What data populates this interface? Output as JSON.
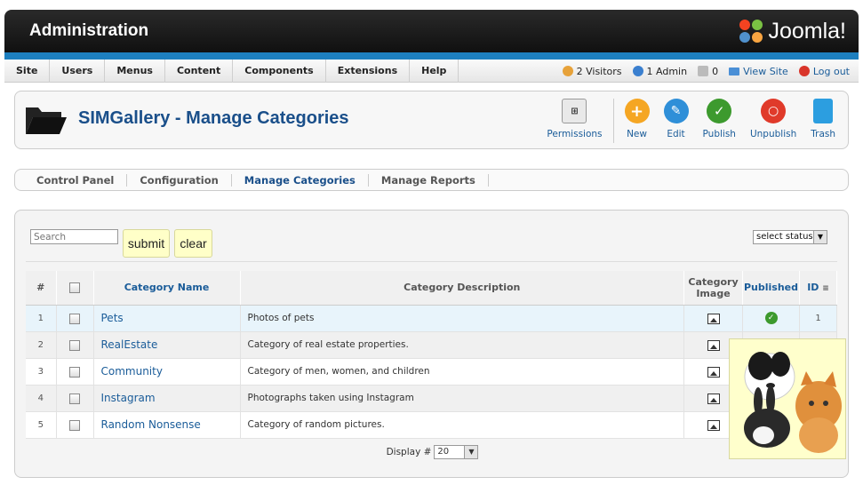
{
  "header": {
    "title": "Administration",
    "brand": "Joomla!"
  },
  "menu": {
    "items": [
      "Site",
      "Users",
      "Menus",
      "Content",
      "Components",
      "Extensions",
      "Help"
    ]
  },
  "status": {
    "visitors": "2 Visitors",
    "admins": "1 Admin",
    "messages": "0",
    "view_site": "View Site",
    "logout": "Log out"
  },
  "toolbar": {
    "page_title": "SIMGallery - Manage Categories",
    "buttons": {
      "permissions": "Permissions",
      "new": "New",
      "edit": "Edit",
      "publish": "Publish",
      "unpublish": "Unpublish",
      "trash": "Trash"
    }
  },
  "submenu": {
    "tabs": [
      "Control Panel",
      "Configuration",
      "Manage Categories",
      "Manage Reports"
    ],
    "active": "Manage Categories"
  },
  "filter": {
    "search_placeholder": "Search",
    "submit_label": "submit",
    "clear_label": "clear",
    "status_select": "select status"
  },
  "table": {
    "columns": {
      "num": "#",
      "name": "Category Name",
      "description": "Category Description",
      "image_line1": "Category",
      "image_line2": "Image",
      "published": "Published",
      "id": "ID"
    },
    "rows": [
      {
        "num": "1",
        "name": "Pets",
        "description": "Photos of pets",
        "id": "1"
      },
      {
        "num": "2",
        "name": "RealEstate",
        "description": "Category of real estate properties.",
        "id": ""
      },
      {
        "num": "3",
        "name": "Community",
        "description": "Category of men, women, and children",
        "id": ""
      },
      {
        "num": "4",
        "name": "Instagram",
        "description": "Photographs taken using Instagram",
        "id": ""
      },
      {
        "num": "5",
        "name": "Random Nonsense",
        "description": "Category of random pictures.",
        "id": ""
      }
    ]
  },
  "pagination": {
    "display_label": "Display #",
    "display_value": "20"
  },
  "colors": {
    "accent_blue": "#1a4f8a",
    "header_strip": "#1d7fbf",
    "published_green": "#3d9a2e"
  }
}
